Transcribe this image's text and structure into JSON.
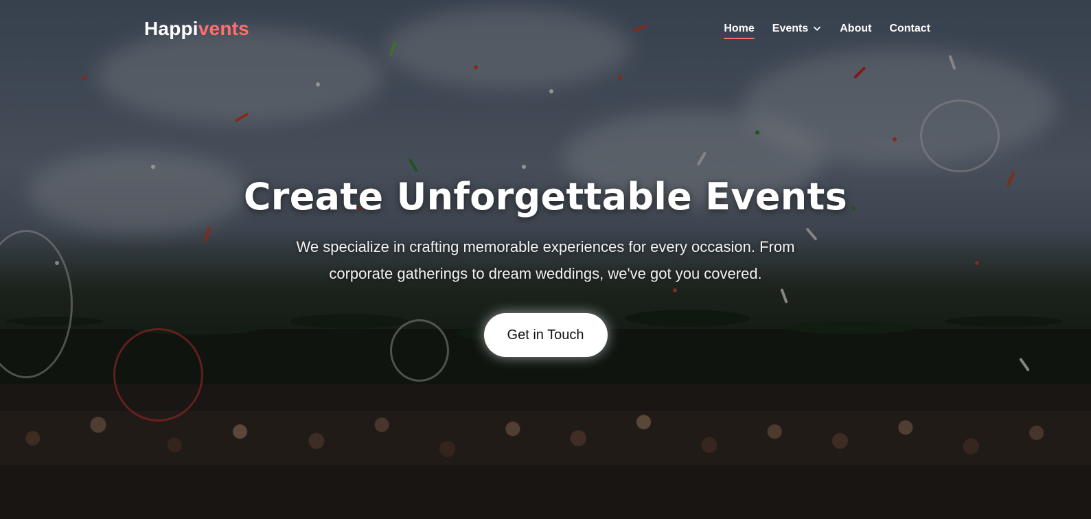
{
  "brand": {
    "part1": "Happi",
    "part2": "vents"
  },
  "nav": {
    "items": [
      {
        "label": "Home",
        "active": true,
        "has_dropdown": false
      },
      {
        "label": "Events",
        "active": false,
        "has_dropdown": true
      },
      {
        "label": "About",
        "active": false,
        "has_dropdown": false
      },
      {
        "label": "Contact",
        "active": false,
        "has_dropdown": false
      }
    ]
  },
  "hero": {
    "title": "Create Unforgettable Events",
    "subtitle": "We specialize in crafting memorable experiences for every occasion. From corporate gatherings to dream weddings, we've got you covered.",
    "cta_label": "Get in Touch"
  },
  "colors": {
    "accent": "#ff6f6f",
    "text": "#ffffff",
    "button_bg": "#ffffff",
    "button_text": "#111111"
  },
  "icons": {
    "dropdown": "chevron-down-icon"
  }
}
